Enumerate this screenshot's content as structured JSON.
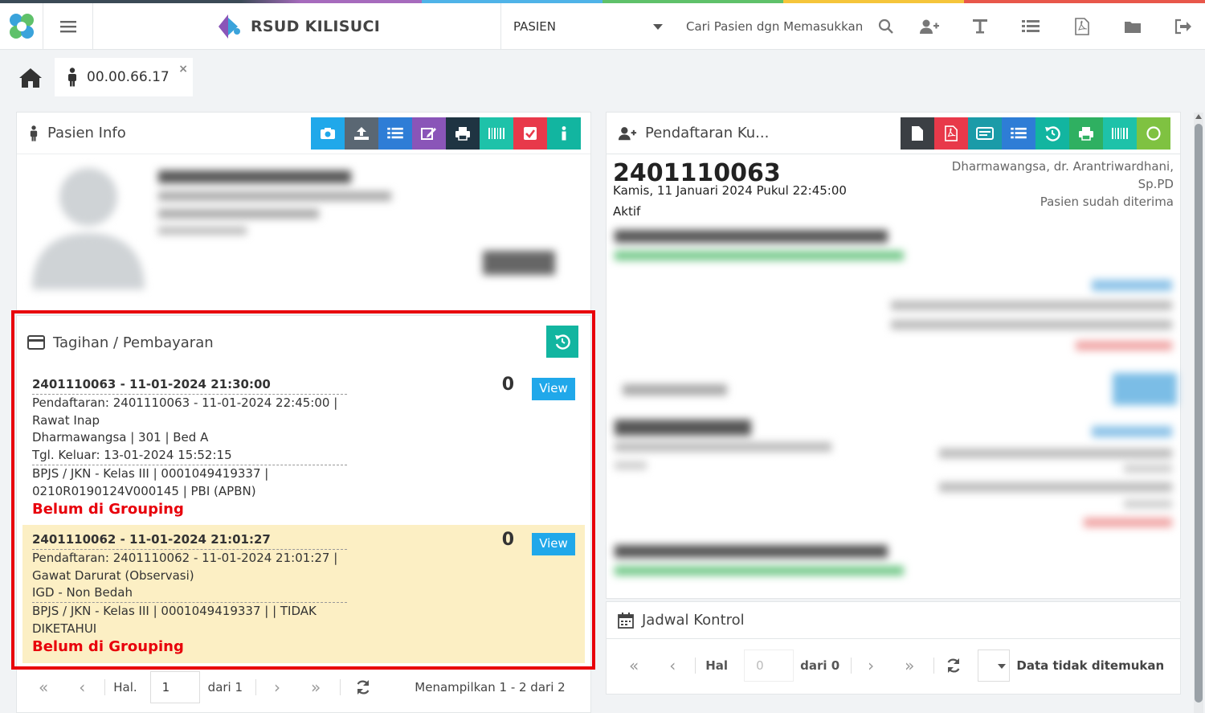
{
  "header": {
    "brand": "RSUD KILISUCI",
    "module_select": "PASIEN",
    "search_placeholder": "Cari Pasien dgn Memasukkan"
  },
  "tabs": {
    "patient_tab_label": "00.00.66.17",
    "close_symbol": "×"
  },
  "pasien_info": {
    "title": "Pasien Info"
  },
  "tagihan": {
    "title": "Tagihan / Pembayaran",
    "items": [
      {
        "header": "2401110063 - 11-01-2024 21:30:00",
        "pendaftaran": "Pendaftaran: 2401110063 - 11-01-2024 22:45:00 |",
        "jenis": "Rawat Inap",
        "ruang": "Dharmawangsa | 301 | Bed A",
        "keluar": "Tgl. Keluar: 13-01-2024 15:52:15",
        "penjamin1": "BPJS / JKN - Kelas III | 0001049419337 |",
        "penjamin2": "0210R0190124V000145 | PBI (APBN)",
        "status": "Belum di Grouping",
        "amount": "0",
        "view": "View"
      },
      {
        "header": "2401110062 - 11-01-2024 21:01:27",
        "pendaftaran": "Pendaftaran: 2401110062 - 11-01-2024 21:01:27 |",
        "jenis": "Gawat Darurat (Observasi)",
        "ruang": "IGD - Non Bedah",
        "penjamin1": "BPJS / JKN - Kelas III | 0001049419337 | | TIDAK",
        "penjamin2": "DIKETAHUI",
        "status": "Belum di Grouping",
        "amount": "0",
        "view": "View"
      }
    ],
    "pager": {
      "hal_label": "Hal.",
      "page_value": "1",
      "dari": "dari 1",
      "showing": "Menampilkan 1 - 2 dari 2"
    }
  },
  "pendaftaran": {
    "title": "Pendaftaran Ku...",
    "reg_no": "2401110063",
    "date": "Kamis, 11 Januari 2024 Pukul 22:45:00",
    "status": "Aktif",
    "doctor_line1": "Dharmawangsa, dr. Arantriwardhani,",
    "doctor_line2": "Sp.PD",
    "accepted": "Pasien sudah diterima"
  },
  "jadwal": {
    "title": "Jadwal Kontrol",
    "hal_label": "Hal",
    "page_value": "0",
    "dari": "dari 0",
    "empty": "Data tidak ditemukan"
  },
  "colors": {
    "info_blue": "#20a8ea",
    "red": "#e8000b",
    "highlight_row": "#fcefc4"
  }
}
